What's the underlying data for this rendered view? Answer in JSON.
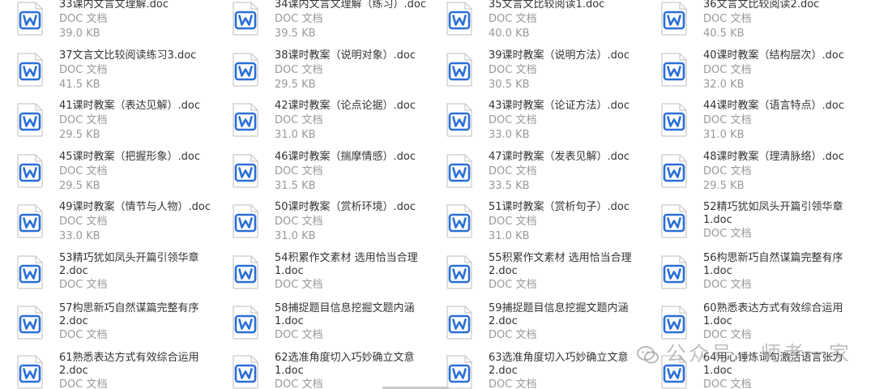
{
  "files": [
    {
      "name": "33课内文言文理解.doc",
      "type": "DOC 文档",
      "size": "39.0 KB"
    },
    {
      "name": "34课内文言文理解（练习）.doc",
      "type": "DOC 文档",
      "size": "39.5 KB"
    },
    {
      "name": "35文言文比较阅读1.doc",
      "type": "DOC 文档",
      "size": "40.0 KB"
    },
    {
      "name": "36文言文比较阅读2.doc",
      "type": "DOC 文档",
      "size": "40.5 KB"
    },
    {
      "name": "37文言文比较阅读练习3.doc",
      "type": "DOC 文档",
      "size": "41.5 KB"
    },
    {
      "name": "38课时教案（说明对象）.doc",
      "type": "DOC 文档",
      "size": "29.5 KB"
    },
    {
      "name": "39课时教案（说明方法）.doc",
      "type": "DOC 文档",
      "size": "30.5 KB"
    },
    {
      "name": "40课时教案（结构层次）.doc",
      "type": "DOC 文档",
      "size": "32.0 KB"
    },
    {
      "name": "41课时教案（表达见解）.doc",
      "type": "DOC 文档",
      "size": "29.5 KB"
    },
    {
      "name": "42课时教案（论点论据）.doc",
      "type": "DOC 文档",
      "size": "31.0 KB"
    },
    {
      "name": "43课时教案（论证方法）.doc",
      "type": "DOC 文档",
      "size": "33.0 KB"
    },
    {
      "name": "44课时教案（语言特点）.doc",
      "type": "DOC 文档",
      "size": "31.0 KB"
    },
    {
      "name": "45课时教案（把握形象）.doc",
      "type": "DOC 文档",
      "size": "29.5 KB"
    },
    {
      "name": "46课时教案（揣摩情感）.doc",
      "type": "DOC 文档",
      "size": "31.5 KB"
    },
    {
      "name": "47课时教案（发表见解）.doc",
      "type": "DOC 文档",
      "size": "33.5 KB"
    },
    {
      "name": "48课时教案（理清脉络）.doc",
      "type": "DOC 文档",
      "size": "29.5 KB"
    },
    {
      "name": "49课时教案（情节与人物）.doc",
      "type": "DOC 文档",
      "size": "33.0 KB"
    },
    {
      "name": "50课时教案（赏析环境）.doc",
      "type": "DOC 文档",
      "size": "31.0 KB"
    },
    {
      "name": "51课时教案（赏析句子）.doc",
      "type": "DOC 文档",
      "size": "31.0 KB"
    },
    {
      "name": "52精巧犹如凤头开篇引领华章1.doc",
      "type": "DOC 文档",
      "size": ""
    },
    {
      "name": "53精巧犹如凤头开篇引领华章2.doc",
      "type": "DOC 文档",
      "size": ""
    },
    {
      "name": "54积累作文素材 选用恰当合理1.doc",
      "type": "DOC 文档",
      "size": ""
    },
    {
      "name": "55积累作文素材 选用恰当合理2.doc",
      "type": "DOC 文档",
      "size": ""
    },
    {
      "name": "56构思新巧自然谋篇完整有序1.doc",
      "type": "DOC 文档",
      "size": ""
    },
    {
      "name": "57构思新巧自然谋篇完整有序2.doc",
      "type": "DOC 文档",
      "size": ""
    },
    {
      "name": "58捕捉题目信息挖掘文题内涵1.doc",
      "type": "DOC 文档",
      "size": ""
    },
    {
      "name": "59捕捉题目信息挖掘文题内涵2.doc",
      "type": "DOC 文档",
      "size": ""
    },
    {
      "name": "60熟悉表达方式有效综合运用1.doc",
      "type": "DOC 文档",
      "size": ""
    },
    {
      "name": "61熟悉表达方式有效综合运用2.doc",
      "type": "DOC 文档",
      "size": ""
    },
    {
      "name": "62选准角度切入巧妙确立文意1.doc",
      "type": "DOC 文档",
      "size": ""
    },
    {
      "name": "63选准角度切入巧妙确立文意2.doc",
      "type": "DOC 文档",
      "size": ""
    },
    {
      "name": "64用心锤炼词句激活语言张力1.doc",
      "type": "DOC 文档",
      "size": ""
    }
  ],
  "icon": {
    "name": "word-doc-icon",
    "accent": "#2b6fd6",
    "page": "#ffffff",
    "border": "#c9c9c9"
  },
  "watermark": {
    "text": "公众号 · 师者一家",
    "icon": "wechat-icon"
  }
}
